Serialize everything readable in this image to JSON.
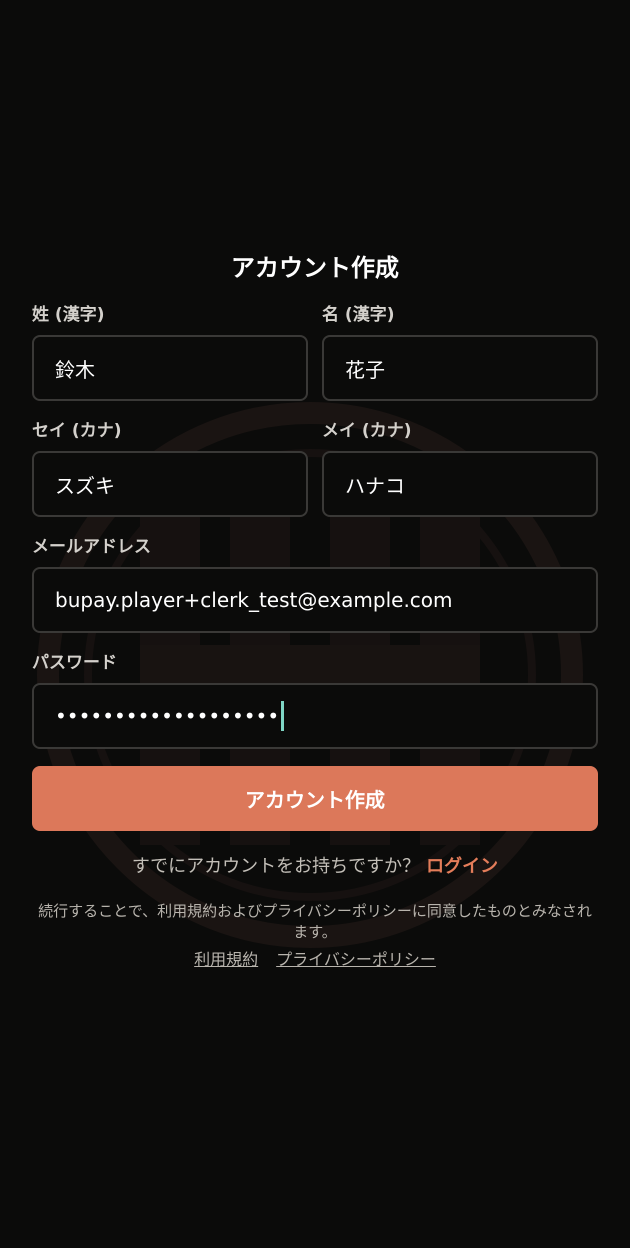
{
  "page": {
    "title": "アカウント作成"
  },
  "form": {
    "last_name_kanji": {
      "label": "姓 (漢字)",
      "value": "鈴木"
    },
    "first_name_kanji": {
      "label": "名 (漢字)",
      "value": "花子"
    },
    "last_name_kana": {
      "label": "セイ (カナ)",
      "value": "スズキ"
    },
    "first_name_kana": {
      "label": "メイ (カナ)",
      "value": "ハナコ"
    },
    "email": {
      "label": "メールアドレス",
      "value": "bupay.player+clerk_test@example.com"
    },
    "password": {
      "label": "パスワード",
      "masked_value": "•••••••••••••••••••"
    }
  },
  "submit": {
    "label": "アカウント作成"
  },
  "login": {
    "prompt": "すでにアカウントをお持ちですか？",
    "link_label": "ログイン"
  },
  "terms": {
    "note": "続行することで、利用規約およびプライバシーポリシーに同意したものとみなされます。",
    "terms_link": "利用規約",
    "privacy_link": "プライバシーポリシー"
  },
  "colors": {
    "background": "#0b0b0a",
    "accent": "#dc785a",
    "link_accent": "#e47d5a",
    "caret": "#7fd6c5",
    "input_border": "#3a3937"
  }
}
